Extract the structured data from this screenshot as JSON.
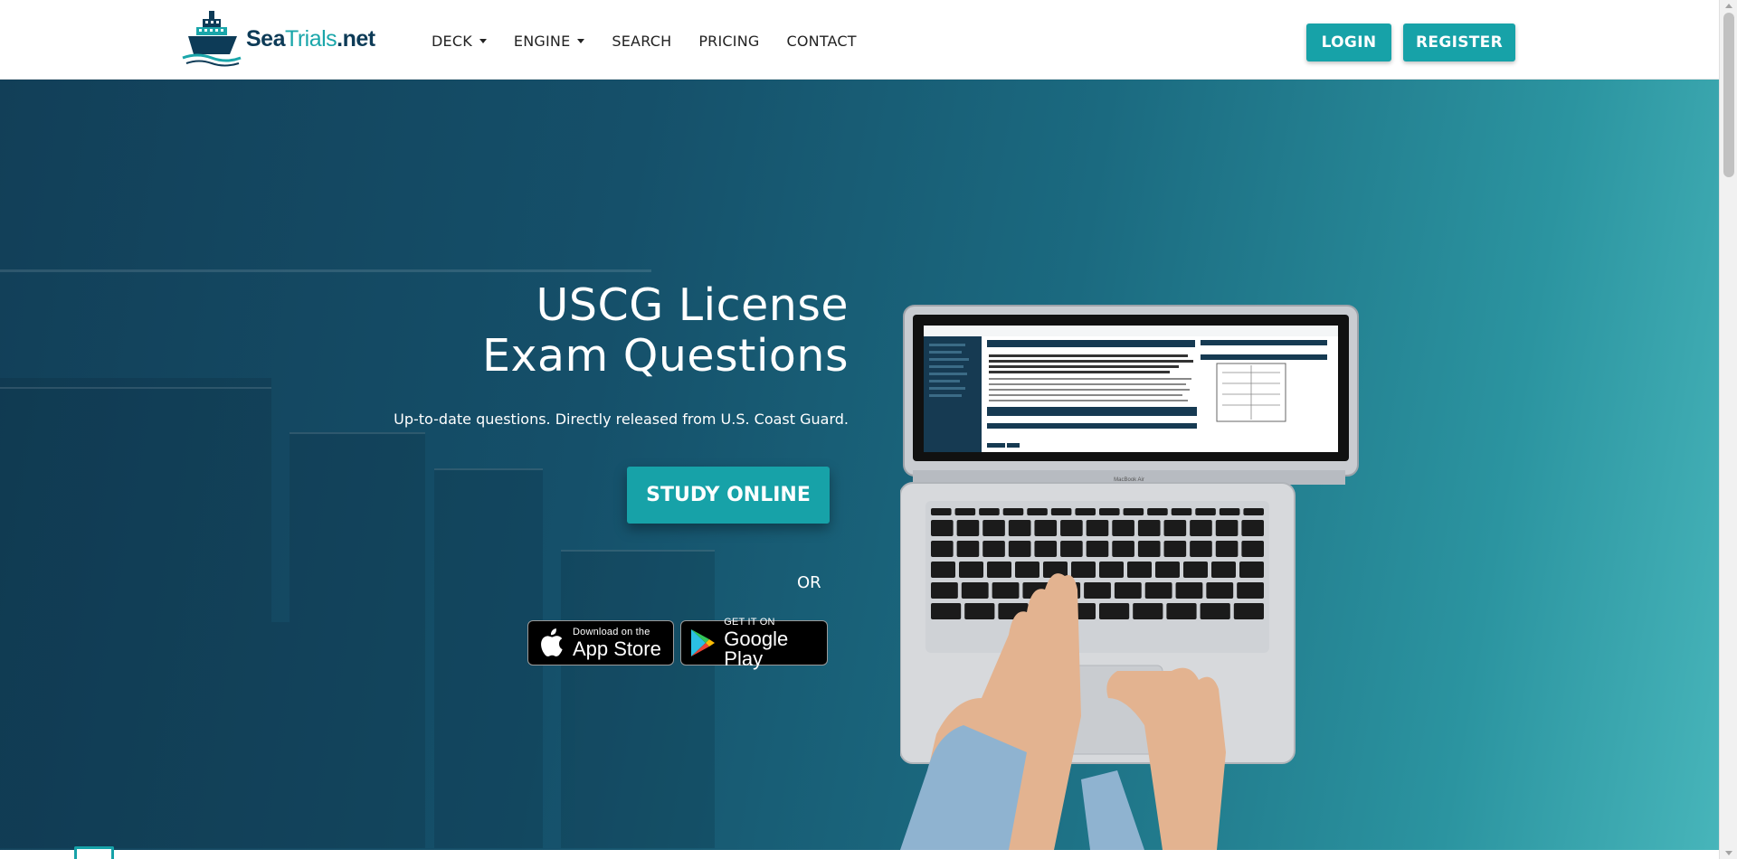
{
  "header": {
    "logo": {
      "text_primary": "Sea",
      "text_accent": "Trials",
      "text_suffix": ".net"
    },
    "nav": [
      {
        "label": "DECK",
        "dropdown": true
      },
      {
        "label": "ENGINE",
        "dropdown": true
      },
      {
        "label": "SEARCH",
        "dropdown": false
      },
      {
        "label": "PRICING",
        "dropdown": false
      },
      {
        "label": "CONTACT",
        "dropdown": false
      }
    ],
    "login_label": "LOGIN",
    "register_label": "REGISTER"
  },
  "hero": {
    "title_line1": "USCG License",
    "title_line2": "Exam Questions",
    "subtitle": "Up-to-date questions. Directly released from U.S. Coast Guard.",
    "cta_label": "STUDY ONLINE",
    "or_label": "OR",
    "app_store": {
      "small": "Download on the",
      "big": "App Store"
    },
    "google_play": {
      "small": "GET IT ON",
      "big": "Google Play"
    },
    "laptop_brand": "MacBook Air"
  },
  "colors": {
    "accent": "#17a2a8",
    "brand_dark": "#0d3b57",
    "hero_start": "#123f58",
    "hero_end": "#47b5ba"
  },
  "icons": [
    "ship-logo-icon",
    "caret-down-icon",
    "apple-icon",
    "google-play-icon",
    "chart-icon"
  ]
}
